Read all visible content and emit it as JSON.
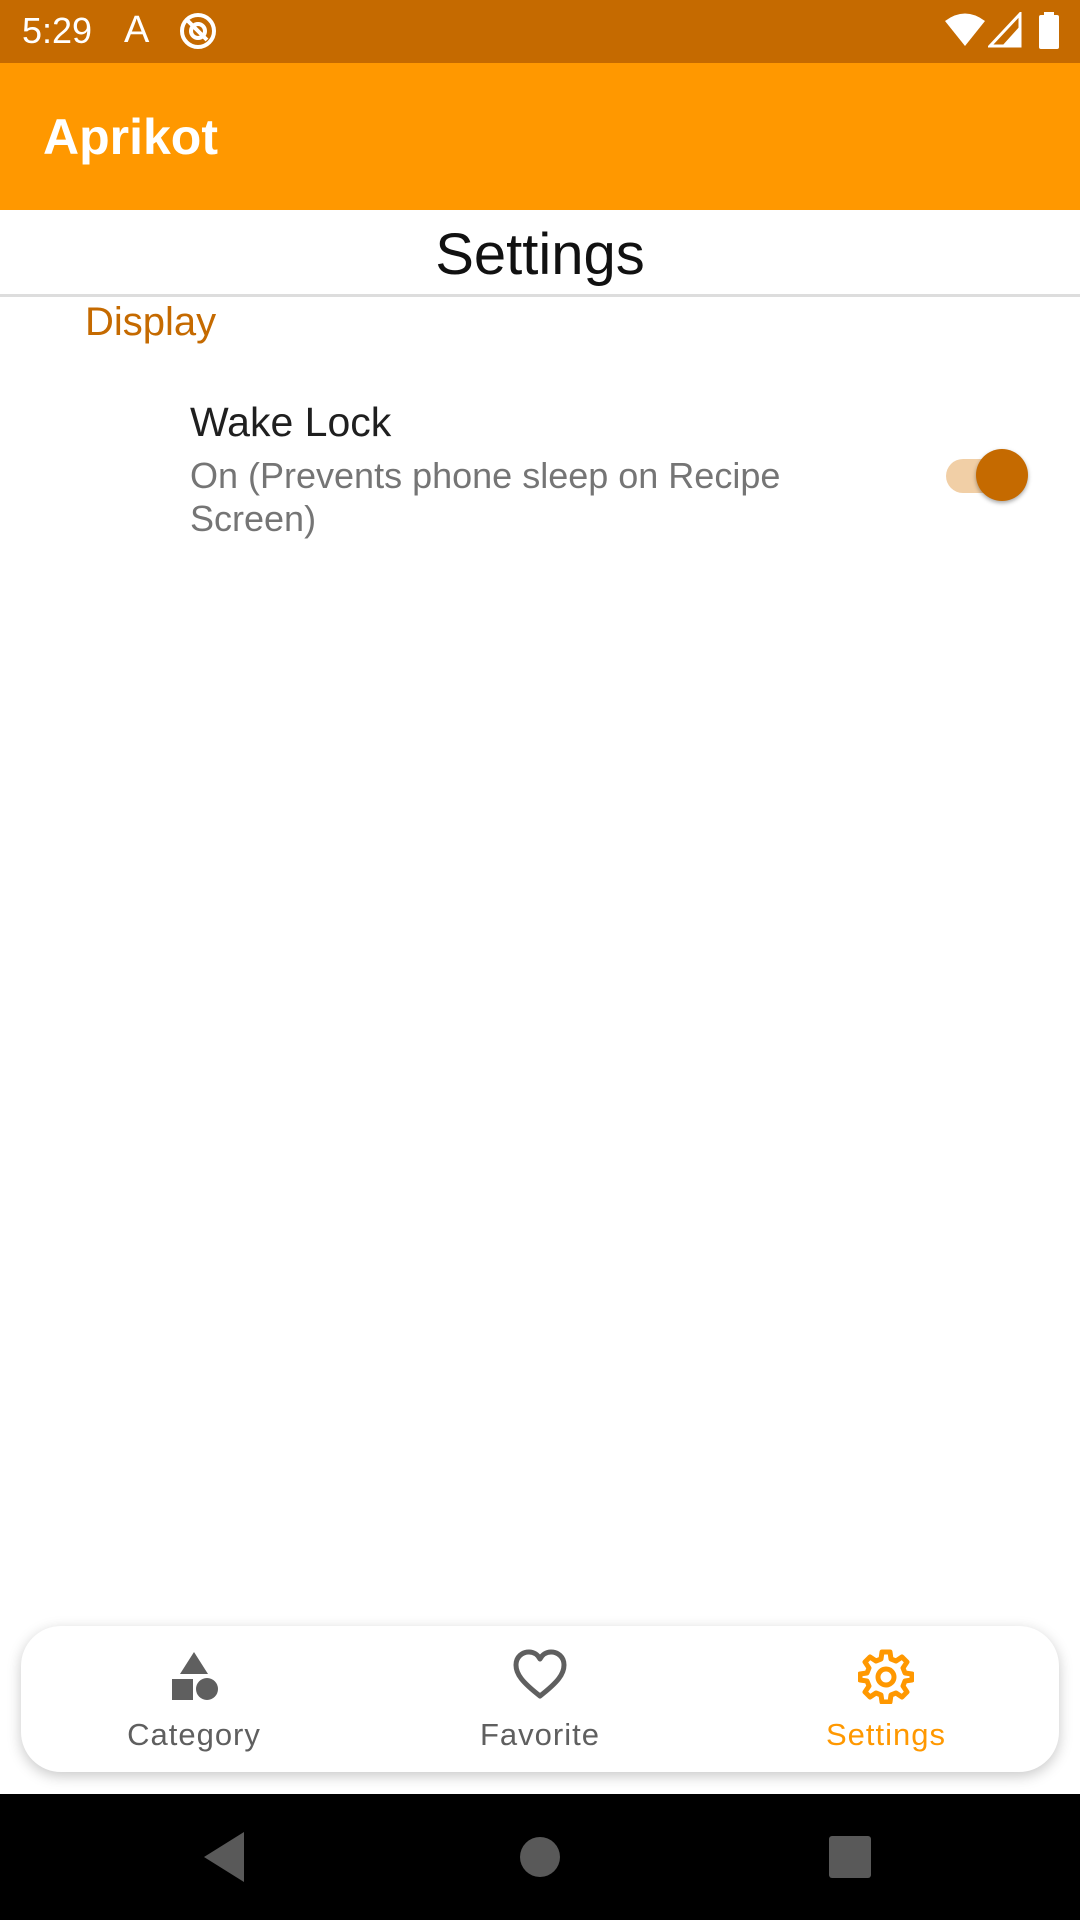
{
  "status_bar": {
    "time": "5:29",
    "notification_letter": "A",
    "icons": [
      "at-sign-icon",
      "wifi-icon",
      "signal-icon",
      "battery-icon"
    ]
  },
  "app_bar": {
    "title": "Aprikot"
  },
  "page": {
    "title": "Settings"
  },
  "settings": {
    "category": "Display",
    "items": [
      {
        "title": "Wake Lock",
        "summary": "On (Prevents phone sleep on Recipe Screen)",
        "enabled": true
      }
    ]
  },
  "bottom_nav": {
    "items": [
      {
        "label": "Category",
        "icon": "category-shapes-icon",
        "active": false
      },
      {
        "label": "Favorite",
        "icon": "heart-icon",
        "active": false
      },
      {
        "label": "Settings",
        "icon": "gear-icon",
        "active": true
      }
    ]
  },
  "system_nav": {
    "buttons": [
      "back-icon",
      "home-icon",
      "recents-icon"
    ]
  },
  "colors": {
    "status_bar": "#c56a00",
    "app_bar": "#ff9800",
    "accent": "#c56a00",
    "nav_active": "#ff9800",
    "nav_inactive": "#5f5f5f",
    "switch_track": "#f1cfa6"
  }
}
